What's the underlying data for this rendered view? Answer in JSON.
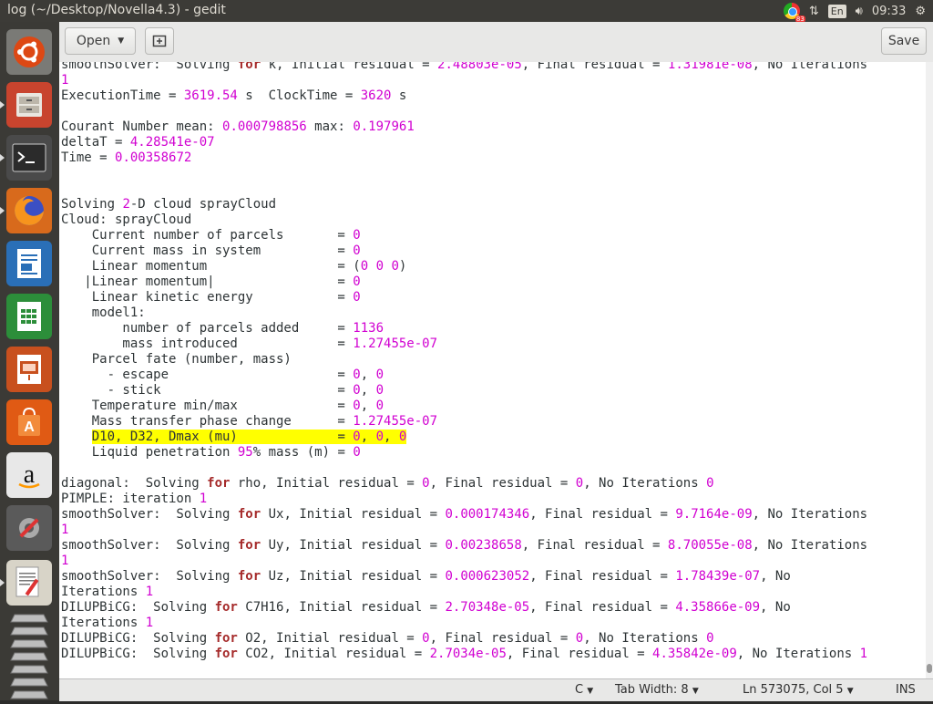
{
  "window_title": "log (~/Desktop/Novella4.3) - gedit",
  "tray": {
    "chrome_badge": "83",
    "language": "En",
    "clock": "09:33"
  },
  "toolbar": {
    "open_label": "Open",
    "save_label": "Save"
  },
  "editor_lines": [
    [
      [
        "t",
        "smoothSolver:  Solving "
      ],
      [
        "k",
        "for"
      ],
      [
        "t",
        " k, Initial residual = "
      ],
      [
        "n",
        "2.48803e-05"
      ],
      [
        "t",
        ", Final residual = "
      ],
      [
        "n",
        "1.31981e-08"
      ],
      [
        "t",
        ", No Iterations"
      ]
    ],
    [
      [
        "n",
        "1"
      ]
    ],
    [
      [
        "t",
        "ExecutionTime = "
      ],
      [
        "n",
        "3619.54"
      ],
      [
        "t",
        " s  ClockTime = "
      ],
      [
        "n",
        "3620"
      ],
      [
        "t",
        " s"
      ]
    ],
    [],
    [
      [
        "t",
        "Courant Number mean: "
      ],
      [
        "n",
        "0.000798856"
      ],
      [
        "t",
        " max: "
      ],
      [
        "n",
        "0.197961"
      ]
    ],
    [
      [
        "t",
        "deltaT = "
      ],
      [
        "n",
        "4.28541e-07"
      ]
    ],
    [
      [
        "t",
        "Time = "
      ],
      [
        "n",
        "0.00358672"
      ]
    ],
    [],
    [],
    [
      [
        "t",
        "Solving "
      ],
      [
        "n",
        "2"
      ],
      [
        "t",
        "-D cloud sprayCloud"
      ]
    ],
    [
      [
        "t",
        "Cloud: sprayCloud"
      ]
    ],
    [
      [
        "t",
        "    Current number of parcels       = "
      ],
      [
        "n",
        "0"
      ]
    ],
    [
      [
        "t",
        "    Current mass in system          = "
      ],
      [
        "n",
        "0"
      ]
    ],
    [
      [
        "t",
        "    Linear momentum                 = ("
      ],
      [
        "n",
        "0 0 0"
      ],
      [
        "t",
        ")"
      ]
    ],
    [
      [
        "t",
        "   |Linear momentum|                = "
      ],
      [
        "n",
        "0"
      ]
    ],
    [
      [
        "t",
        "    Linear kinetic energy           = "
      ],
      [
        "n",
        "0"
      ]
    ],
    [
      [
        "t",
        "    model1:"
      ]
    ],
    [
      [
        "t",
        "        number of parcels added     = "
      ],
      [
        "n",
        "1136"
      ]
    ],
    [
      [
        "t",
        "        mass introduced             = "
      ],
      [
        "n",
        "1.27455e-07"
      ]
    ],
    [
      [
        "t",
        "    Parcel fate (number, mass)"
      ]
    ],
    [
      [
        "t",
        "      - escape                      = "
      ],
      [
        "n",
        "0"
      ],
      [
        "t",
        ", "
      ],
      [
        "n",
        "0"
      ]
    ],
    [
      [
        "t",
        "      - stick                       = "
      ],
      [
        "n",
        "0"
      ],
      [
        "t",
        ", "
      ],
      [
        "n",
        "0"
      ]
    ],
    [
      [
        "t",
        "    Temperature min/max             = "
      ],
      [
        "n",
        "0"
      ],
      [
        "t",
        ", "
      ],
      [
        "n",
        "0"
      ]
    ],
    [
      [
        "t",
        "    Mass transfer phase change      = "
      ],
      [
        "n",
        "1.27455e-07"
      ]
    ],
    [
      [
        "h",
        "    "
      ],
      [
        "h",
        "D10, D32, Dmax (mu)             = "
      ],
      [
        "hn",
        "0"
      ],
      [
        "h",
        ", "
      ],
      [
        "hn",
        "0"
      ],
      [
        "h",
        ", "
      ],
      [
        "hn",
        "0"
      ]
    ],
    [
      [
        "t",
        "    Liquid penetration "
      ],
      [
        "n",
        "95"
      ],
      [
        "t",
        "% mass (m) = "
      ],
      [
        "n",
        "0"
      ]
    ],
    [],
    [
      [
        "t",
        "diagonal:  Solving "
      ],
      [
        "k",
        "for"
      ],
      [
        "t",
        " rho, Initial residual = "
      ],
      [
        "n",
        "0"
      ],
      [
        "t",
        ", Final residual = "
      ],
      [
        "n",
        "0"
      ],
      [
        "t",
        ", No Iterations "
      ],
      [
        "n",
        "0"
      ]
    ],
    [
      [
        "t",
        "PIMPLE: iteration "
      ],
      [
        "n",
        "1"
      ]
    ],
    [
      [
        "t",
        "smoothSolver:  Solving "
      ],
      [
        "k",
        "for"
      ],
      [
        "t",
        " Ux, Initial residual = "
      ],
      [
        "n",
        "0.000174346"
      ],
      [
        "t",
        ", Final residual = "
      ],
      [
        "n",
        "9.7164e-09"
      ],
      [
        "t",
        ", No Iterations"
      ]
    ],
    [
      [
        "n",
        "1"
      ]
    ],
    [
      [
        "t",
        "smoothSolver:  Solving "
      ],
      [
        "k",
        "for"
      ],
      [
        "t",
        " Uy, Initial residual = "
      ],
      [
        "n",
        "0.00238658"
      ],
      [
        "t",
        ", Final residual = "
      ],
      [
        "n",
        "8.70055e-08"
      ],
      [
        "t",
        ", No Iterations"
      ]
    ],
    [
      [
        "n",
        "1"
      ]
    ],
    [
      [
        "t",
        "smoothSolver:  Solving "
      ],
      [
        "k",
        "for"
      ],
      [
        "t",
        " Uz, Initial residual = "
      ],
      [
        "n",
        "0.000623052"
      ],
      [
        "t",
        ", Final residual = "
      ],
      [
        "n",
        "1.78439e-07"
      ],
      [
        "t",
        ", No"
      ]
    ],
    [
      [
        "t",
        "Iterations "
      ],
      [
        "n",
        "1"
      ]
    ],
    [
      [
        "t",
        "DILUPBiCG:  Solving "
      ],
      [
        "k",
        "for"
      ],
      [
        "t",
        " C7H16, Initial residual = "
      ],
      [
        "n",
        "2.70348e-05"
      ],
      [
        "t",
        ", Final residual = "
      ],
      [
        "n",
        "4.35866e-09"
      ],
      [
        "t",
        ", No"
      ]
    ],
    [
      [
        "t",
        "Iterations "
      ],
      [
        "n",
        "1"
      ]
    ],
    [
      [
        "t",
        "DILUPBiCG:  Solving "
      ],
      [
        "k",
        "for"
      ],
      [
        "t",
        " O2, Initial residual = "
      ],
      [
        "n",
        "0"
      ],
      [
        "t",
        ", Final residual = "
      ],
      [
        "n",
        "0"
      ],
      [
        "t",
        ", No Iterations "
      ],
      [
        "n",
        "0"
      ]
    ],
    [
      [
        "t",
        "DILUPBiCG:  Solving "
      ],
      [
        "k",
        "for"
      ],
      [
        "t",
        " CO2, Initial residual = "
      ],
      [
        "n",
        "2.7034e-05"
      ],
      [
        "t",
        ", Final residual = "
      ],
      [
        "n",
        "4.35842e-09"
      ],
      [
        "t",
        ", No Iterations "
      ],
      [
        "n",
        "1"
      ]
    ]
  ],
  "statusbar": {
    "language": "C",
    "tab_width": "Tab Width: 8",
    "position": "Ln 573075, Col 5",
    "mode": "INS"
  }
}
